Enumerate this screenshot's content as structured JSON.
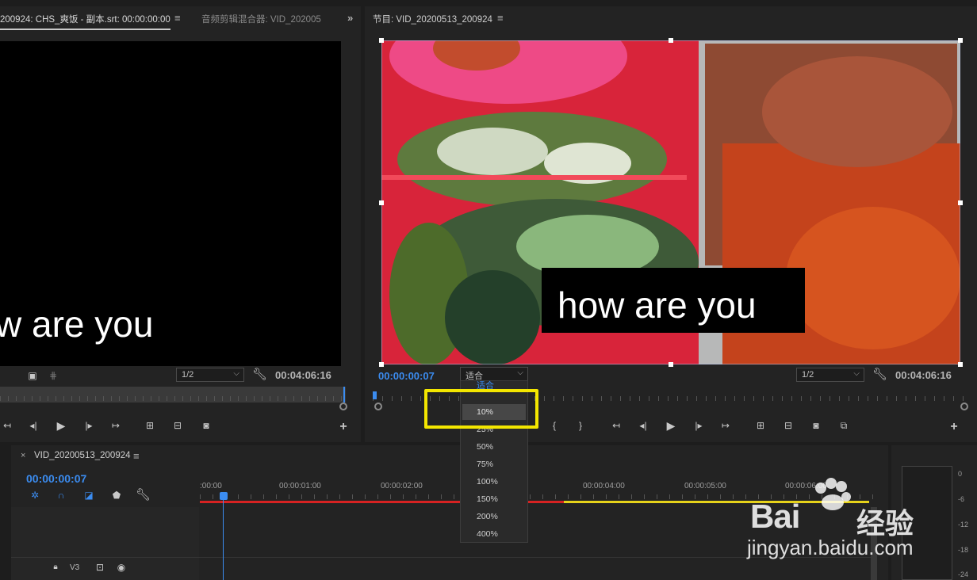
{
  "source_monitor": {
    "tab_label": "200924:  CHS_爽饭 - 副本.srt: 00:00:00:00",
    "second_tab_label": "音频剪辑混合器: VID_202005",
    "caption_text": "w are you",
    "resolution": "1/2",
    "duration": "00:04:06:16"
  },
  "program_monitor": {
    "tab_label": "节目: VID_20200513_200924",
    "caption_text": "how are you",
    "current_time": "00:00:00:07",
    "zoom_value": "适合",
    "resolution": "1/2",
    "duration": "00:04:06:16"
  },
  "zoom_dropdown": {
    "options": [
      "适合",
      "10%",
      "25%",
      "50%",
      "75%",
      "100%",
      "150%",
      "200%",
      "400%"
    ],
    "highlighted": "10%"
  },
  "timeline": {
    "tab_label": "VID_20200513_200924",
    "close_glyph": "×",
    "current_time": "00:00:00:07",
    "ruler": [
      ":00:00",
      "00:00:01:00",
      "00:00:02:00",
      "00:00:04:00",
      "00:00:05:00",
      "00:00:06:00"
    ],
    "track_label": "V3"
  },
  "audio_meter": {
    "labels": [
      "0",
      "-6",
      "-12",
      "-18",
      "-24"
    ]
  },
  "watermark": {
    "brand": "Bai",
    "brand_cn": "经验",
    "url": "jingyan.baidu.com"
  },
  "colors": {
    "accent_blue": "#3b8cf0",
    "highlight_yellow": "#f3e600",
    "track_red": "#d62222",
    "track_yellow": "#e6d21a"
  }
}
